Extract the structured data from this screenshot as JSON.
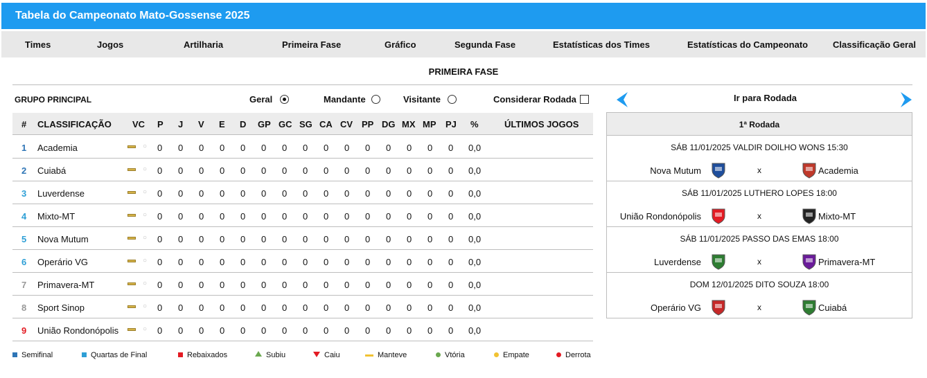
{
  "header": {
    "title": "Tabela do Campeonato Mato-Gossense 2025"
  },
  "nav": [
    "Times",
    "Jogos",
    "Artilharia",
    "Primeira Fase",
    "Gráfico",
    "Segunda Fase",
    "Estatísticas dos Times",
    "Estatísticas do Campeonato",
    "Classificação Geral"
  ],
  "section": {
    "title": "PRIMEIRA FASE"
  },
  "filters": {
    "group": "GRUPO PRINCIPAL",
    "geral": "Geral",
    "mandante": "Mandante",
    "visitante": "Visitante",
    "considerar": "Considerar Rodada",
    "selected": "Geral"
  },
  "table": {
    "headers": [
      "#",
      "CLASSIFICAÇÃO",
      "VC",
      "P",
      "J",
      "V",
      "E",
      "D",
      "GP",
      "GC",
      "SG",
      "CA",
      "CV",
      "PP",
      "DG",
      "MX",
      "MP",
      "PJ",
      "%",
      "ÚLTIMOS JOGOS"
    ],
    "vc_marker": "○",
    "rows": [
      {
        "pos": "1",
        "team": "Academia",
        "pos_color": "#2e75b6",
        "stats": [
          "0",
          "0",
          "0",
          "0",
          "0",
          "0",
          "0",
          "0",
          "0",
          "0",
          "0",
          "0",
          "0",
          "0",
          "0"
        ],
        "pct": "0,0"
      },
      {
        "pos": "2",
        "team": "Cuiabá",
        "pos_color": "#2e75b6",
        "stats": [
          "0",
          "0",
          "0",
          "0",
          "0",
          "0",
          "0",
          "0",
          "0",
          "0",
          "0",
          "0",
          "0",
          "0",
          "0"
        ],
        "pct": "0,0"
      },
      {
        "pos": "3",
        "team": "Luverdense",
        "pos_color": "#2e9fd6",
        "stats": [
          "0",
          "0",
          "0",
          "0",
          "0",
          "0",
          "0",
          "0",
          "0",
          "0",
          "0",
          "0",
          "0",
          "0",
          "0"
        ],
        "pct": "0,0"
      },
      {
        "pos": "4",
        "team": "Mixto-MT",
        "pos_color": "#2e9fd6",
        "stats": [
          "0",
          "0",
          "0",
          "0",
          "0",
          "0",
          "0",
          "0",
          "0",
          "0",
          "0",
          "0",
          "0",
          "0",
          "0"
        ],
        "pct": "0,0"
      },
      {
        "pos": "5",
        "team": "Nova Mutum",
        "pos_color": "#2e9fd6",
        "stats": [
          "0",
          "0",
          "0",
          "0",
          "0",
          "0",
          "0",
          "0",
          "0",
          "0",
          "0",
          "0",
          "0",
          "0",
          "0"
        ],
        "pct": "0,0"
      },
      {
        "pos": "6",
        "team": "Operário VG",
        "pos_color": "#2e9fd6",
        "stats": [
          "0",
          "0",
          "0",
          "0",
          "0",
          "0",
          "0",
          "0",
          "0",
          "0",
          "0",
          "0",
          "0",
          "0",
          "0"
        ],
        "pct": "0,0"
      },
      {
        "pos": "7",
        "team": "Primavera-MT",
        "pos_color": "#999999",
        "stats": [
          "0",
          "0",
          "0",
          "0",
          "0",
          "0",
          "0",
          "0",
          "0",
          "0",
          "0",
          "0",
          "0",
          "0",
          "0"
        ],
        "pct": "0,0"
      },
      {
        "pos": "8",
        "team": "Sport Sinop",
        "pos_color": "#999999",
        "stats": [
          "0",
          "0",
          "0",
          "0",
          "0",
          "0",
          "0",
          "0",
          "0",
          "0",
          "0",
          "0",
          "0",
          "0",
          "0"
        ],
        "pct": "0,0"
      },
      {
        "pos": "9",
        "team": "União Rondonópolis",
        "pos_color": "#e31b23",
        "stats": [
          "0",
          "0",
          "0",
          "0",
          "0",
          "0",
          "0",
          "0",
          "0",
          "0",
          "0",
          "0",
          "0",
          "0",
          "0"
        ],
        "pct": "0,0"
      }
    ]
  },
  "legend": [
    {
      "label": "Semifinal",
      "color": "#2e75b6",
      "shape": "square"
    },
    {
      "label": "Quartas de Final",
      "color": "#2e9fd6",
      "shape": "square"
    },
    {
      "label": "Rebaixados",
      "color": "#e31b23",
      "shape": "square"
    },
    {
      "label": "Subiu",
      "color": "#6aa84f",
      "shape": "triangle-up"
    },
    {
      "label": "Caiu",
      "color": "#e31b23",
      "shape": "triangle-down"
    },
    {
      "label": "Manteve",
      "color": "#f1c232",
      "shape": "bar"
    },
    {
      "label": "Vtória",
      "color": "#6aa84f",
      "shape": "dot"
    },
    {
      "label": "Empate",
      "color": "#f1c232",
      "shape": "dot"
    },
    {
      "label": "Derrota",
      "color": "#e31b23",
      "shape": "dot"
    }
  ],
  "rounds": {
    "goto_label": "Ir para Rodada",
    "current": "1ª Rodada",
    "accent": "#1e9bf0",
    "matches": [
      {
        "info": "SÁB 11/01/2025 VALDIR DOILHO WONS 15:30",
        "home": "Nova Mutum",
        "vs": "x",
        "away": "Academia",
        "home_crest": "#1f4e9c",
        "away_crest": "#c0392b"
      },
      {
        "info": "SÁB 11/01/2025 LUTHERO LOPES 18:00",
        "home": "União Rondonópolis",
        "vs": "x",
        "away": "Mixto-MT",
        "home_crest": "#e31b23",
        "away_crest": "#222222"
      },
      {
        "info": "SÁB 11/01/2025 PASSO DAS EMAS 18:00",
        "home": "Luverdense",
        "vs": "x",
        "away": "Primavera-MT",
        "home_crest": "#2e7d32",
        "away_crest": "#6a1b9a"
      },
      {
        "info": "DOM 12/01/2025 DITO SOUZA 18:00",
        "home": "Operário VG",
        "vs": "x",
        "away": "Cuiabá",
        "home_crest": "#c62828",
        "away_crest": "#2e7d32"
      }
    ]
  }
}
